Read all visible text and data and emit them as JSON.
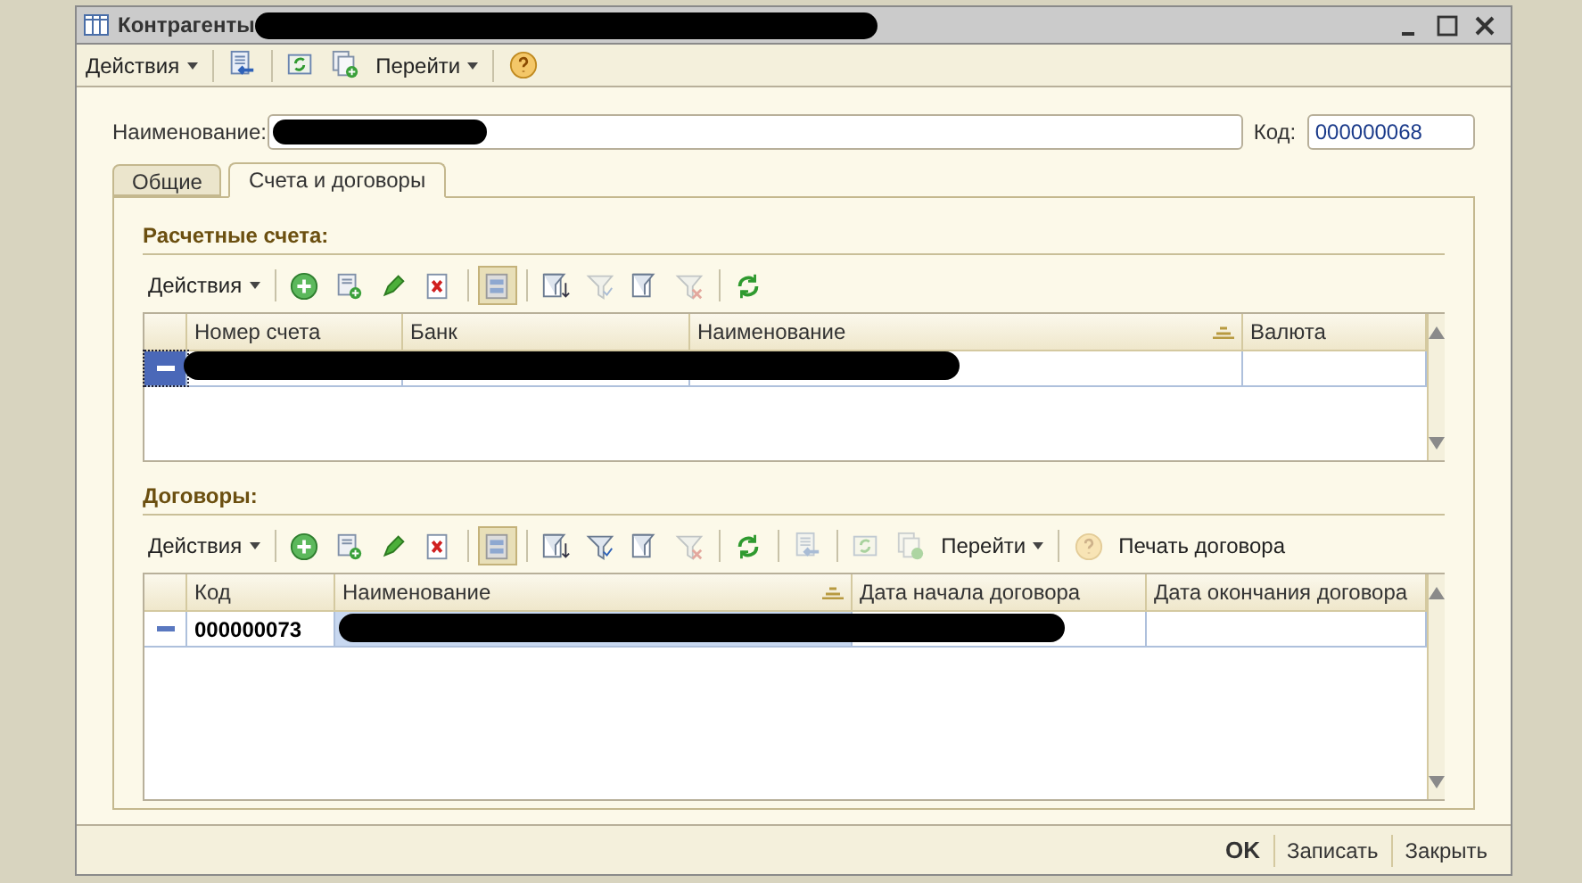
{
  "window": {
    "title": "Контрагенты",
    "title_redacted": true
  },
  "toolbar": [
    {
      "kind": "menu",
      "label": "Действия"
    },
    {
      "kind": "sep"
    },
    {
      "kind": "icon",
      "disabled": false
    },
    {
      "kind": "sep"
    },
    {
      "kind": "icon",
      "disabled": false
    },
    {
      "kind": "icon",
      "disabled": false
    },
    {
      "kind": "menu",
      "label": "Перейти"
    },
    {
      "kind": "sep"
    },
    {
      "kind": "icon",
      "disabled": false
    }
  ],
  "fields": {
    "name_label": "Наименование:",
    "name_redacted": true,
    "code_label": "Код:",
    "code_value": "000000068"
  },
  "tabs": [
    {
      "label": "Общие",
      "selected": false
    },
    {
      "label": "Счета и договоры",
      "selected": true
    }
  ],
  "sections": [
    {
      "title": "Расчетные счета:",
      "toolbar": [
        {
          "kind": "menu",
          "label": "Действия"
        },
        {
          "kind": "sep"
        },
        {
          "kind": "icon",
          "disabled": false
        },
        {
          "kind": "icon",
          "disabled": false
        },
        {
          "kind": "icon",
          "disabled": false
        },
        {
          "kind": "icon",
          "disabled": false
        },
        {
          "kind": "sep"
        },
        {
          "kind": "toggle",
          "on": true
        },
        {
          "kind": "sep"
        },
        {
          "kind": "icon",
          "disabled": false
        },
        {
          "kind": "icon",
          "disabled": true
        },
        {
          "kind": "icon",
          "disabled": false
        },
        {
          "kind": "icon",
          "disabled": true
        },
        {
          "kind": "sep"
        },
        {
          "kind": "icon",
          "disabled": false
        }
      ],
      "columns": [
        {
          "label": "Номер счета",
          "sorted": false
        },
        {
          "label": "Банк",
          "sorted": false
        },
        {
          "label": "Наименование",
          "sorted": true
        },
        {
          "label": "Валюта",
          "sorted": false
        }
      ],
      "rows": [
        {
          "selected": true,
          "redacted": true
        }
      ]
    },
    {
      "title": "Договоры:",
      "toolbar": [
        {
          "kind": "menu",
          "label": "Действия"
        },
        {
          "kind": "sep"
        },
        {
          "kind": "icon",
          "disabled": false
        },
        {
          "kind": "icon",
          "disabled": false
        },
        {
          "kind": "icon",
          "disabled": false
        },
        {
          "kind": "icon",
          "disabled": false
        },
        {
          "kind": "sep"
        },
        {
          "kind": "toggle",
          "on": true
        },
        {
          "kind": "sep"
        },
        {
          "kind": "icon",
          "disabled": false
        },
        {
          "kind": "icon",
          "disabled": false
        },
        {
          "kind": "icon",
          "disabled": false
        },
        {
          "kind": "icon",
          "disabled": true
        },
        {
          "kind": "sep"
        },
        {
          "kind": "icon",
          "disabled": false
        },
        {
          "kind": "sep"
        },
        {
          "kind": "icon",
          "disabled": true
        },
        {
          "kind": "sep"
        },
        {
          "kind": "icon",
          "disabled": true
        },
        {
          "kind": "icon",
          "disabled": true
        },
        {
          "kind": "menu",
          "label": "Перейти"
        },
        {
          "kind": "sep"
        },
        {
          "kind": "icon",
          "disabled": true
        },
        {
          "kind": "button",
          "label": "Печать договора"
        }
      ],
      "columns": [
        {
          "label": "Код",
          "sorted": false
        },
        {
          "label": "Наименование",
          "sorted": true
        },
        {
          "label": "Дата начала договора",
          "sorted": false
        },
        {
          "label": "Дата окончания договора",
          "sorted": false
        }
      ],
      "rows": [
        {
          "selected": false,
          "redacted": true,
          "code": "000000073"
        }
      ]
    }
  ],
  "buttons": [
    {
      "label": "OK",
      "default": true
    },
    {
      "label": "Записать",
      "default": false
    },
    {
      "label": "Закрыть",
      "default": false
    }
  ]
}
